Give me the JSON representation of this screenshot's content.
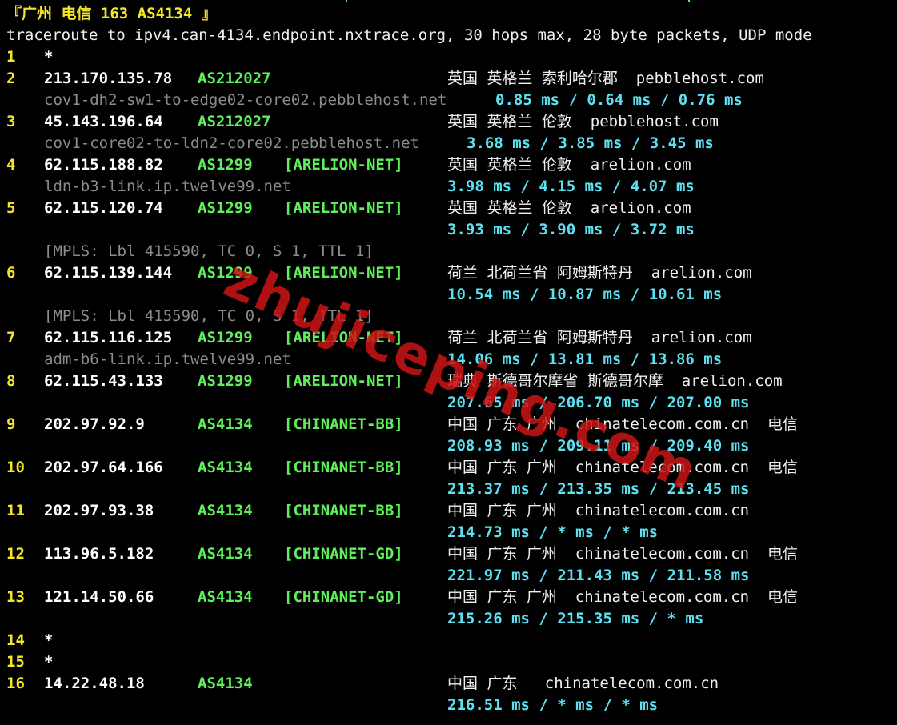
{
  "title": "『广州 电信 163 AS4134 』",
  "command": "traceroute to ipv4.can-4134.endpoint.nxtrace.org, 30 hops max, 28 byte packets, UDP mode",
  "watermark": "zhujiceping.com",
  "hops": [
    {
      "n": "1",
      "ip": "*",
      "asn": "",
      "tag": "",
      "geo": "",
      "host": "",
      "rtt": "",
      "mpls": ""
    },
    {
      "n": "2",
      "ip": "213.170.135.78",
      "asn": "AS212027",
      "tag": "",
      "geo": "英国 英格兰 索利哈尔郡  pebblehost.com",
      "host": "cov1-dh2-sw1-to-edge02-core02.pebblehost.net",
      "rtt": "0.85 ms / 0.64 ms / 0.76 ms",
      "mpls": ""
    },
    {
      "n": "3",
      "ip": "45.143.196.64",
      "asn": "AS212027",
      "tag": "",
      "geo": "英国 英格兰 伦敦  pebblehost.com",
      "host": "cov1-core02-to-ldn2-core02.pebblehost.net",
      "rtt": "3.68 ms / 3.85 ms / 3.45 ms",
      "mpls": ""
    },
    {
      "n": "4",
      "ip": "62.115.188.82",
      "asn": "AS1299",
      "tag": "[ARELION-NET]",
      "geo": "英国 英格兰 伦敦  arelion.com",
      "host": "ldn-b3-link.ip.twelve99.net",
      "rtt": "3.98 ms / 4.15 ms / 4.07 ms",
      "mpls": ""
    },
    {
      "n": "5",
      "ip": "62.115.120.74",
      "asn": "AS1299",
      "tag": "[ARELION-NET]",
      "geo": "英国 英格兰 伦敦  arelion.com",
      "host": "",
      "rtt": "3.93 ms / 3.90 ms / 3.72 ms",
      "mpls": "[MPLS: Lbl 415590, TC 0, S 1, TTL 1]"
    },
    {
      "n": "6",
      "ip": "62.115.139.144",
      "asn": "AS1299",
      "tag": "[ARELION-NET]",
      "geo": "荷兰 北荷兰省 阿姆斯特丹  arelion.com",
      "host": "",
      "rtt": "10.54 ms / 10.87 ms / 10.61 ms",
      "mpls": "[MPLS: Lbl 415590, TC 0, S 1, TTL 1]"
    },
    {
      "n": "7",
      "ip": "62.115.116.125",
      "asn": "AS1299",
      "tag": "[ARELION-NET]",
      "geo": "荷兰 北荷兰省 阿姆斯特丹  arelion.com",
      "host": "adm-b6-link.ip.twelve99.net",
      "rtt": "14.06 ms / 13.81 ms / 13.86 ms",
      "mpls": ""
    },
    {
      "n": "8",
      "ip": "62.115.43.133",
      "asn": "AS1299",
      "tag": "[ARELION-NET]",
      "geo": "瑞典 斯德哥尔摩省 斯德哥尔摩  arelion.com",
      "host": "",
      "rtt": "207.65 ms / 206.70 ms / 207.00 ms",
      "mpls": ""
    },
    {
      "n": "9",
      "ip": "202.97.92.9",
      "asn": "AS4134",
      "tag": "[CHINANET-BB]",
      "geo": "中国 广东 广州  chinatelecom.com.cn  电信",
      "host": "",
      "rtt": "208.93 ms / 209.11 ms / 209.40 ms",
      "mpls": ""
    },
    {
      "n": "10",
      "ip": "202.97.64.166",
      "asn": "AS4134",
      "tag": "[CHINANET-BB]",
      "geo": "中国 广东 广州  chinatelecom.com.cn  电信",
      "host": "",
      "rtt": "213.37 ms / 213.35 ms / 213.45 ms",
      "mpls": ""
    },
    {
      "n": "11",
      "ip": "202.97.93.38",
      "asn": "AS4134",
      "tag": "[CHINANET-BB]",
      "geo": "中国 广东 广州  chinatelecom.com.cn",
      "host": "",
      "rtt": "214.73 ms / * ms / * ms",
      "mpls": ""
    },
    {
      "n": "12",
      "ip": "113.96.5.182",
      "asn": "AS4134",
      "tag": "[CHINANET-GD]",
      "geo": "中国 广东 广州  chinatelecom.com.cn  电信",
      "host": "",
      "rtt": "221.97 ms / 211.43 ms / 211.58 ms",
      "mpls": ""
    },
    {
      "n": "13",
      "ip": "121.14.50.66",
      "asn": "AS4134",
      "tag": "[CHINANET-GD]",
      "geo": "中国 广东 广州  chinatelecom.com.cn  电信",
      "host": "",
      "rtt": "215.26 ms / 215.35 ms / * ms",
      "mpls": ""
    },
    {
      "n": "14",
      "ip": "*",
      "asn": "",
      "tag": "",
      "geo": "",
      "host": "",
      "rtt": "",
      "mpls": ""
    },
    {
      "n": "15",
      "ip": "*",
      "asn": "",
      "tag": "",
      "geo": "",
      "host": "",
      "rtt": "",
      "mpls": ""
    },
    {
      "n": "16",
      "ip": "14.22.48.18",
      "asn": "AS4134",
      "tag": "",
      "geo": "中国 广东   chinatelecom.com.cn",
      "host": "",
      "rtt": "216.51 ms / * ms / * ms",
      "mpls": ""
    }
  ]
}
